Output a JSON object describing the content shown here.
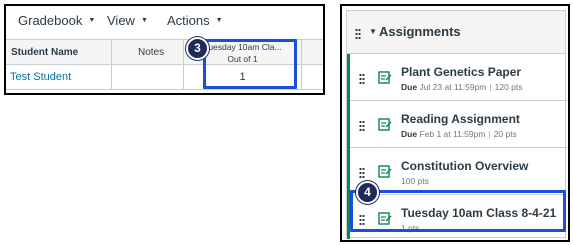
{
  "gradebook": {
    "menus": [
      {
        "label": "Gradebook"
      },
      {
        "label": "View"
      },
      {
        "label": "Actions"
      }
    ],
    "columns": {
      "student": "Student Name",
      "notes": "Notes",
      "assignment_title": "Tuesday 10am Cla...",
      "assignment_sub": "Out of 1"
    },
    "row": {
      "student": "Test Student",
      "notes": "",
      "grade": "1"
    }
  },
  "callouts": {
    "first": "3",
    "second": "4"
  },
  "assignments": {
    "group_title": "Assignments",
    "items": [
      {
        "name": "Plant Genetics Paper",
        "due_label": "Due",
        "due": "Jul 23 at 11:59pm",
        "points": "120 pts"
      },
      {
        "name": "Reading Assignment",
        "due_label": "Due",
        "due": "Feb 1 at 11:59pm",
        "points": "20 pts"
      },
      {
        "name": "Constitution Overview",
        "points": "100 pts"
      },
      {
        "name": "Tuesday 10am Class 8-4-21",
        "points": "1 pts"
      }
    ]
  },
  "colors": {
    "highlight": "#1a4ed8",
    "badge": "#1f2b5a",
    "published_green": "#0b874b",
    "link": "#0770a3"
  }
}
